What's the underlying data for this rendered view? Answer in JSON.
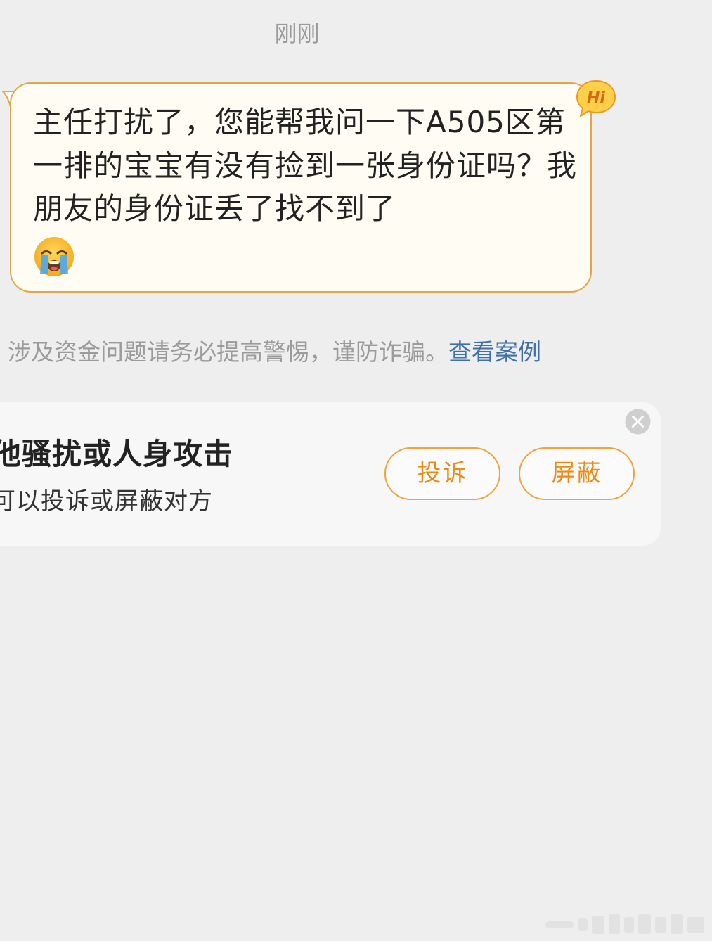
{
  "chat": {
    "timestamp": "刚刚",
    "message": {
      "text": "主任打扰了，您能帮我问一下A505区第一排的宝宝有没有捡到一张身份证吗？我朋友的身份证丢了找不到了",
      "emoji": "loudly-crying-face",
      "badge_text": "Hi"
    },
    "warning": {
      "text": "涉及资金问题请务必提高警惕，谨防诈骗。",
      "link": "查看案例"
    }
  },
  "report_card": {
    "title": "他骚扰或人身攻击",
    "subtitle": "可以投诉或屏蔽对方",
    "complain_label": "投诉",
    "block_label": "屏蔽",
    "close_icon": "close-icon"
  },
  "colors": {
    "background": "#eeeeee",
    "bubble_fill": "#fffcf3",
    "bubble_border": "#e2a64a",
    "accent_orange": "#ee8a14",
    "link_blue": "#3d6fa8",
    "muted_text": "#9b9b9b"
  }
}
